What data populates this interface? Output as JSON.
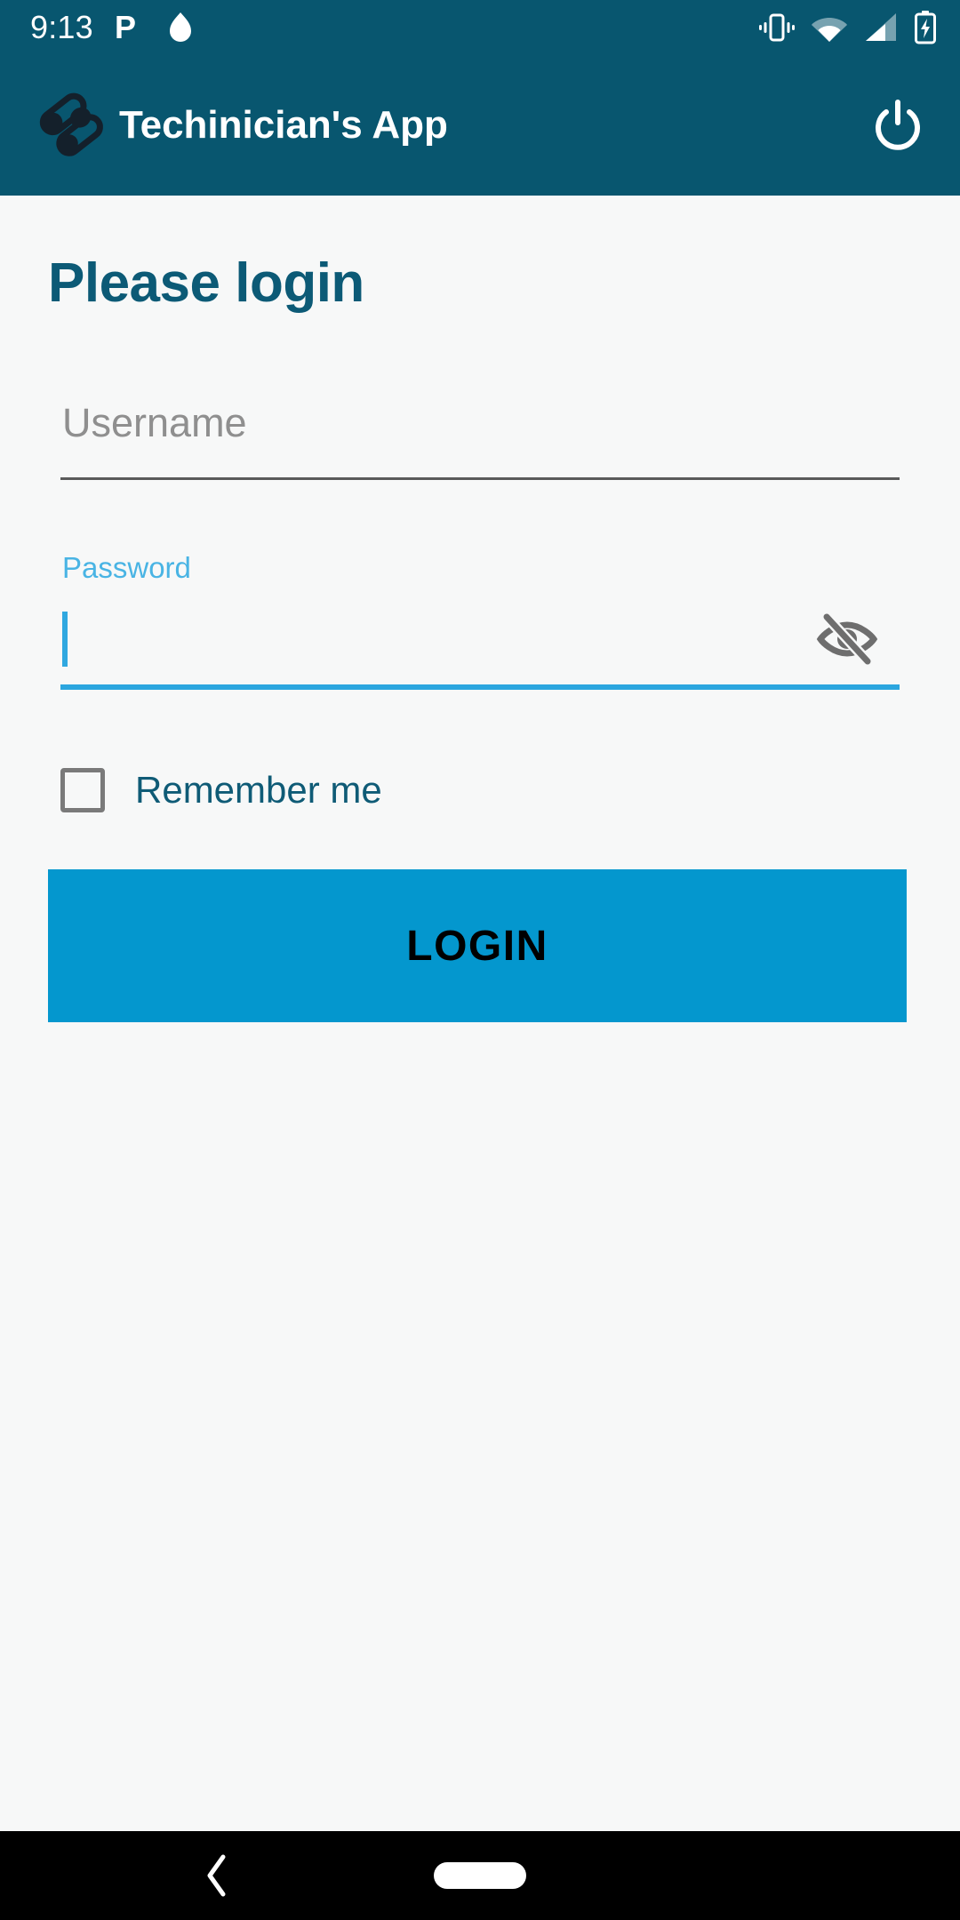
{
  "status_bar": {
    "clock": "9:13",
    "left_icons": [
      "parking-p-icon",
      "flame-icon"
    ],
    "right_icons": [
      "vibrate-icon",
      "wifi-icon",
      "cellular-signal-icon",
      "battery-charging-icon"
    ],
    "background": "#08566f",
    "foreground": "#ffffff"
  },
  "app_bar": {
    "title": "Techinician's App",
    "logo_icon": "chain-link-logo-icon",
    "power_icon": "power-icon",
    "background": "#08566f",
    "text_color": "#ffffff"
  },
  "page": {
    "title": "Please login",
    "title_color": "#0c5a76",
    "background": "#f7f8f8"
  },
  "form": {
    "username": {
      "label": "Username",
      "placeholder": "Username",
      "value": "",
      "focused": false,
      "underline_color": "#5a5a5a",
      "placeholder_color": "#8f8f8f"
    },
    "password": {
      "label": "Password",
      "placeholder": "",
      "value": "",
      "focused": true,
      "masked": true,
      "label_color": "#49b4e4",
      "underline_color": "#2ba6df",
      "toggle_icon": "eye-off-icon",
      "toggle_icon_color": "#6e6e6e"
    },
    "remember_me": {
      "label": "Remember me",
      "checked": false,
      "label_color": "#0f5b76",
      "box_color": "#7a7a7a"
    },
    "submit": {
      "label": "LOGIN",
      "background": "#0497ce",
      "text_color": "#000000"
    }
  },
  "nav_bar": {
    "background": "#000000",
    "back_icon": "back-chevron-icon",
    "home_icon": "home-pill-icon"
  }
}
